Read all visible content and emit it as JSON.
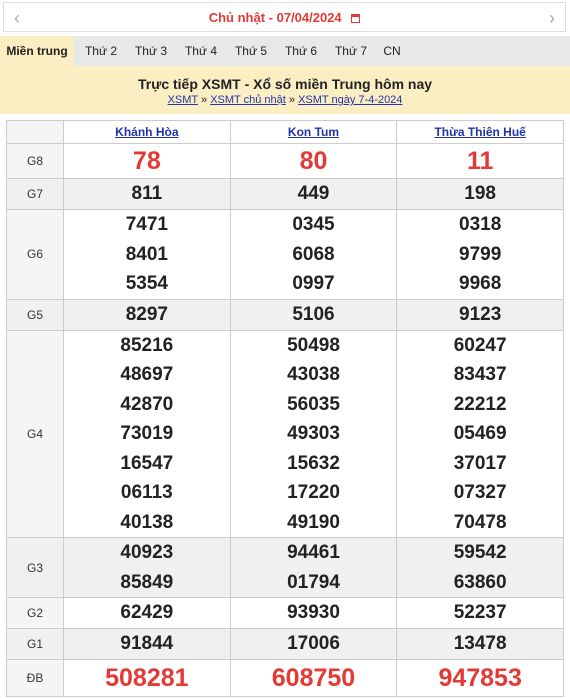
{
  "datebar": {
    "label": "Chủ nhật -",
    "date": "07/04/2024",
    "prev_icon": "‹",
    "next_icon": "›"
  },
  "tabs": [
    "Miền trung",
    "Thứ 2",
    "Thứ 3",
    "Thứ 4",
    "Thứ 5",
    "Thứ 6",
    "Thứ 7",
    "CN"
  ],
  "header": {
    "title": "Trực tiếp XSMT - Xổ số miền Trung hôm nay",
    "breadcrumb": [
      "XSMT",
      "XSMT chủ nhật",
      "XSMT ngày 7-4-2024"
    ],
    "sep": "»"
  },
  "table": {
    "provinces": [
      "Khánh Hòa",
      "Kon Tum",
      "Thừa Thiên Huế"
    ],
    "g8": {
      "label": "G8",
      "values": [
        "78",
        "80",
        "11"
      ]
    },
    "g7": {
      "label": "G7",
      "values": [
        "811",
        "449",
        "198"
      ]
    },
    "g6": {
      "label": "G6",
      "values": [
        [
          "7471",
          "8401",
          "5354"
        ],
        [
          "0345",
          "6068",
          "0997"
        ],
        [
          "0318",
          "9799",
          "9968"
        ]
      ]
    },
    "g5": {
      "label": "G5",
      "values": [
        "8297",
        "5106",
        "9123"
      ]
    },
    "g4": {
      "label": "G4",
      "values": [
        [
          "85216",
          "48697",
          "42870",
          "73019",
          "16547",
          "06113",
          "40138"
        ],
        [
          "50498",
          "43038",
          "56035",
          "49303",
          "15632",
          "17220",
          "49190"
        ],
        [
          "60247",
          "83437",
          "22212",
          "05469",
          "37017",
          "07327",
          "70478"
        ]
      ]
    },
    "g3": {
      "label": "G3",
      "values": [
        [
          "40923",
          "85849"
        ],
        [
          "94461",
          "01794"
        ],
        [
          "59542",
          "63860"
        ]
      ]
    },
    "g2": {
      "label": "G2",
      "values": [
        "62429",
        "93930",
        "52237"
      ]
    },
    "g1": {
      "label": "G1",
      "values": [
        "91844",
        "17006",
        "13478"
      ]
    },
    "db": {
      "label": "ĐB",
      "values": [
        "508281",
        "608750",
        "947853"
      ]
    }
  }
}
